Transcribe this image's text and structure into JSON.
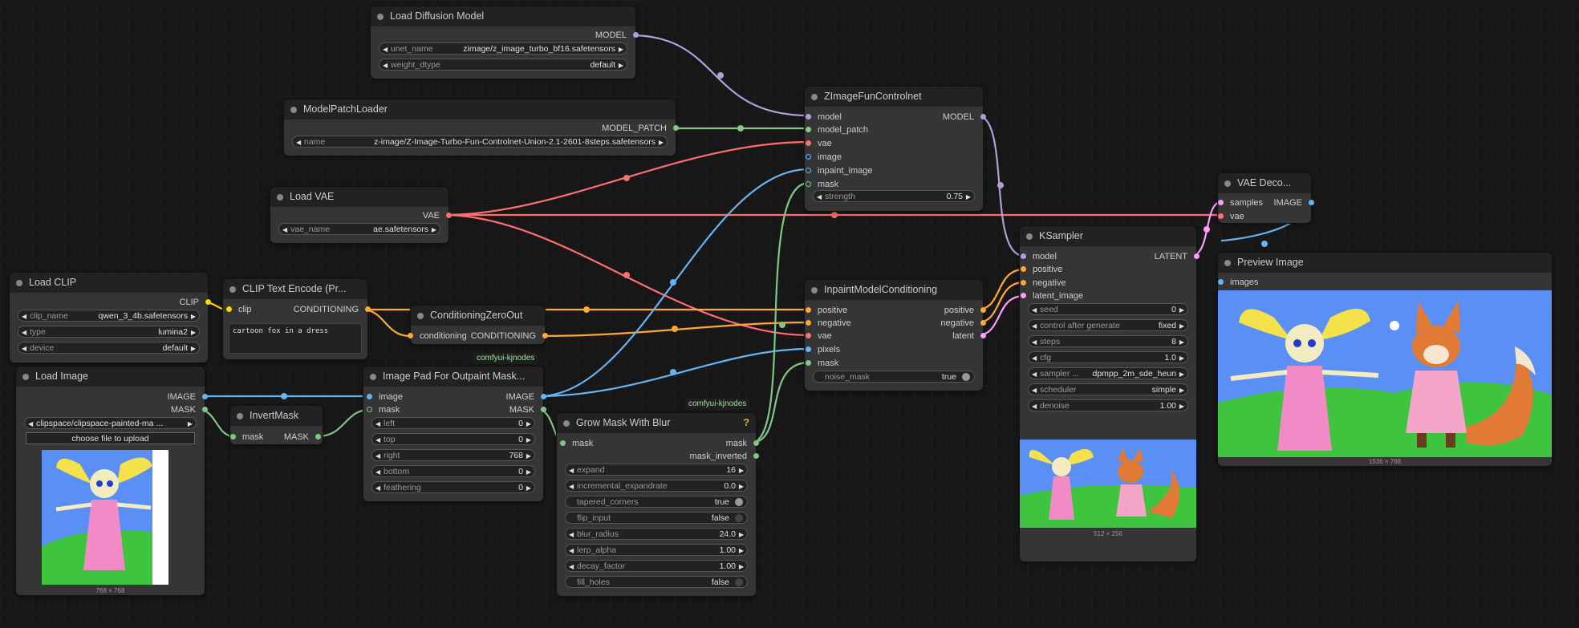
{
  "colors": {
    "model": "#b39ddb",
    "clip": "#ffd500",
    "vae": "#ff6e6e",
    "conditioning": "#ffa931",
    "image": "#64b5f6",
    "mask": "#81c784",
    "latent": "#ff9cf9",
    "model_patch": "#8bc78b"
  },
  "nodes": {
    "load_diffusion": {
      "title": "Load Diffusion Model",
      "out_model": "MODEL",
      "unet_name_label": "unet_name",
      "unet_name": "zimage/z_image_turbo_bf16.safetensors",
      "weight_dtype_label": "weight_dtype",
      "weight_dtype": "default"
    },
    "model_patch_loader": {
      "title": "ModelPatchLoader",
      "out": "MODEL_PATCH",
      "name_label": "name",
      "name": "z-image/Z-Image-Turbo-Fun-Controlnet-Union-2.1-2601-8steps.safetensors"
    },
    "load_vae": {
      "title": "Load VAE",
      "out": "VAE",
      "vae_name_label": "vae_name",
      "vae_name": "ae.safetensors"
    },
    "load_clip": {
      "title": "Load CLIP",
      "out": "CLIP",
      "clip_name_label": "clip_name",
      "clip_name": "qwen_3_4b.safetensors",
      "type_label": "type",
      "type": "lumina2",
      "device_label": "device",
      "device": "default"
    },
    "clip_text_encode": {
      "title": "CLIP Text Encode (Pr...",
      "in_clip": "clip",
      "out": "CONDITIONING",
      "text": "cartoon fox in a dress"
    },
    "conditioning_zero_out": {
      "title": "ConditioningZeroOut",
      "in": "conditioning",
      "out": "CONDITIONING"
    },
    "load_image": {
      "title": "Load Image",
      "out_image": "IMAGE",
      "out_mask": "MASK",
      "image_label": "image",
      "image": "clipspace/clipspace-painted-ma ...",
      "upload": "choose file to upload",
      "size": "768 × 768"
    },
    "invert_mask": {
      "title": "InvertMask",
      "in": "mask",
      "out": "MASK"
    },
    "image_pad": {
      "title": "Image Pad For Outpaint Mask...",
      "badge": "comfyui-kjnodes",
      "in_image": "image",
      "in_mask": "mask",
      "out_image": "IMAGE",
      "out_mask": "MASK",
      "widgets": [
        {
          "label": "left",
          "value": "0"
        },
        {
          "label": "top",
          "value": "0"
        },
        {
          "label": "right",
          "value": "768"
        },
        {
          "label": "bottom",
          "value": "0"
        },
        {
          "label": "feathering",
          "value": "0"
        }
      ]
    },
    "grow_mask": {
      "title": "Grow Mask With Blur",
      "badge": "comfyui-kjnodes",
      "help": "?",
      "in_mask": "mask",
      "out_mask": "mask",
      "out_mask_inverted": "mask_inverted",
      "widgets": [
        {
          "label": "expand",
          "value": "16"
        },
        {
          "label": "incremental_expandrate",
          "value": "0.0"
        },
        {
          "label": "tapered_corners",
          "value": "true",
          "bool": true,
          "on": true
        },
        {
          "label": "flip_input",
          "value": "false",
          "bool": true,
          "on": false
        },
        {
          "label": "blur_radius",
          "value": "24.0"
        },
        {
          "label": "lerp_alpha",
          "value": "1.00"
        },
        {
          "label": "decay_factor",
          "value": "1.00"
        },
        {
          "label": "fill_holes",
          "value": "false",
          "bool": true,
          "on": false
        }
      ]
    },
    "zimage_controlnet": {
      "title": "ZImageFunControlnet",
      "inputs": [
        "model",
        "model_patch",
        "vae",
        "image",
        "inpaint_image",
        "mask"
      ],
      "out": "MODEL",
      "strength_label": "strength",
      "strength": "0.75"
    },
    "inpaint_conditioning": {
      "title": "InpaintModelConditioning",
      "inputs": [
        "positive",
        "negative",
        "vae",
        "pixels",
        "mask"
      ],
      "outputs": [
        "positive",
        "negative",
        "latent"
      ],
      "noise_mask_label": "noise_mask",
      "noise_mask": "true"
    },
    "ksampler": {
      "title": "KSampler",
      "inputs": [
        "model",
        "positive",
        "negative",
        "latent_image"
      ],
      "out": "LATENT",
      "widgets": [
        {
          "label": "seed",
          "value": "0"
        },
        {
          "label": "control after generate",
          "value": "fixed"
        },
        {
          "label": "steps",
          "value": "8"
        },
        {
          "label": "cfg",
          "value": "1.0"
        },
        {
          "label": "sampler ...",
          "value": "dpmpp_2m_sde_heun"
        },
        {
          "label": "scheduler",
          "value": "simple"
        },
        {
          "label": "denoise",
          "value": "1.00"
        }
      ],
      "preview_size": "512 × 256"
    },
    "vae_decode": {
      "title": "VAE Deco...",
      "in_samples": "samples",
      "in_vae": "vae",
      "out": "IMAGE"
    },
    "preview_image": {
      "title": "Preview Image",
      "in": "images",
      "size": "1536 × 768"
    }
  }
}
